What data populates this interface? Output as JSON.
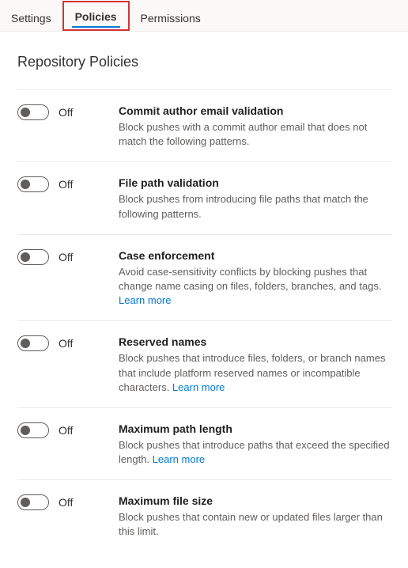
{
  "tabs": {
    "settings": "Settings",
    "policies": "Policies",
    "permissions": "Permissions"
  },
  "pageTitle": "Repository Policies",
  "toggleOff": "Off",
  "learnMore": "Learn more",
  "policies": {
    "commitAuthor": {
      "title": "Commit author email validation",
      "desc": "Block pushes with a commit author email that does not match the following patterns."
    },
    "filePath": {
      "title": "File path validation",
      "desc": "Block pushes from introducing file paths that match the following patterns."
    },
    "caseEnforcement": {
      "title": "Case enforcement",
      "desc": "Avoid case-sensitivity conflicts by blocking pushes that change name casing on files, folders, branches, and tags. "
    },
    "reservedNames": {
      "title": "Reserved names",
      "desc": "Block pushes that introduce files, folders, or branch names that include platform reserved names or incompatible characters. "
    },
    "maxPathLength": {
      "title": "Maximum path length",
      "desc": "Block pushes that introduce paths that exceed the specified length. "
    },
    "maxFileSize": {
      "title": "Maximum file size",
      "desc": "Block pushes that contain new or updated files larger than this limit."
    }
  }
}
